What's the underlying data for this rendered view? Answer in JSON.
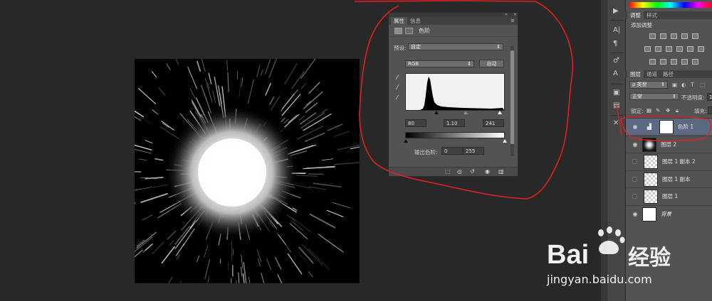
{
  "properties_panel": {
    "tabs": [
      "属性",
      "信息"
    ],
    "menu_icon": "panel-menu-icon",
    "collapse_icon": "double-chevron-icon",
    "close_icon": "close-icon",
    "title": "色阶",
    "preset_label": "预设:",
    "preset_value": "自定",
    "channel_value": "RGB",
    "auto_button": "自动",
    "input_black": "80",
    "input_gamma": "1.10",
    "input_white": "241",
    "output_label": "输出色阶:",
    "output_black": "0",
    "output_white": "255"
  },
  "adjust_panel": {
    "tabs": [
      "调整",
      "样式"
    ],
    "title": "添加调整"
  },
  "layers_panel": {
    "tabs": [
      "图层",
      "通道",
      "路径"
    ],
    "filter_value": "ρ 类型",
    "blend_mode": "正常",
    "opacity_label": "不透明度:",
    "opacity_value": "1",
    "lock_label": "锁定:",
    "fill_label": "填充:",
    "layers": [
      {
        "name": "色阶 1",
        "visible": true,
        "selected": true
      },
      {
        "name": "图层 2",
        "visible": true,
        "selected": false
      },
      {
        "name": "图层 1 副本 2",
        "visible": false,
        "selected": false
      },
      {
        "name": "图层 1 副本",
        "visible": false,
        "selected": false
      },
      {
        "name": "图层 1",
        "visible": false,
        "selected": false
      },
      {
        "name": "背景",
        "visible": true,
        "selected": false
      }
    ]
  },
  "watermark": {
    "brand": "Bai",
    "brand_cn": "经验",
    "url": "jingyan.baidu.com"
  },
  "colors": {
    "annotation": "#e02020",
    "selection": "#5b6a82",
    "panel": "#535353",
    "workspace": "#282828"
  }
}
